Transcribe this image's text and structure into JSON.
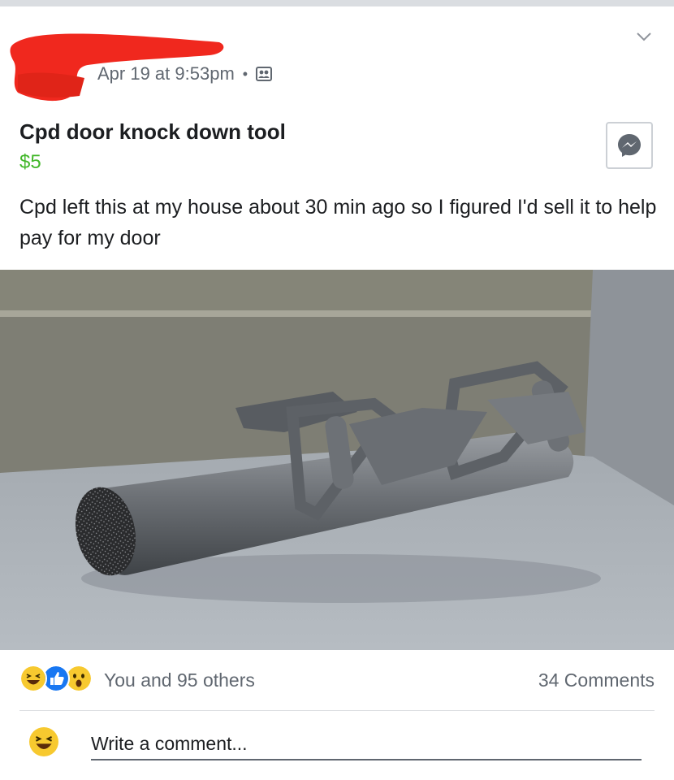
{
  "post": {
    "timestamp": "Apr 19 at 9:53pm",
    "separator": "•",
    "privacy_icon": "friends-icon",
    "menu_icon": "chevron-down-icon"
  },
  "listing": {
    "title": "Cpd door knock down tool",
    "price": "$5",
    "message_icon": "messenger-icon",
    "description": "Cpd left this at my house about 30 min ago so I figured I'd sell it to help pay for my door"
  },
  "photo": {
    "subject": "battering ram"
  },
  "engagement": {
    "reaction_icons": [
      "haha-icon",
      "like-icon",
      "wow-icon"
    ],
    "likes_text": "You and 95 others",
    "comments_text": "34 Comments"
  },
  "composer": {
    "placeholder": "Write a comment...",
    "avatar_icon": "haha-icon"
  },
  "colors": {
    "price": "#42b72a",
    "like_blue": "#1877f2",
    "reaction_yellow": "#f7c92f",
    "redaction": "#f0281e"
  }
}
